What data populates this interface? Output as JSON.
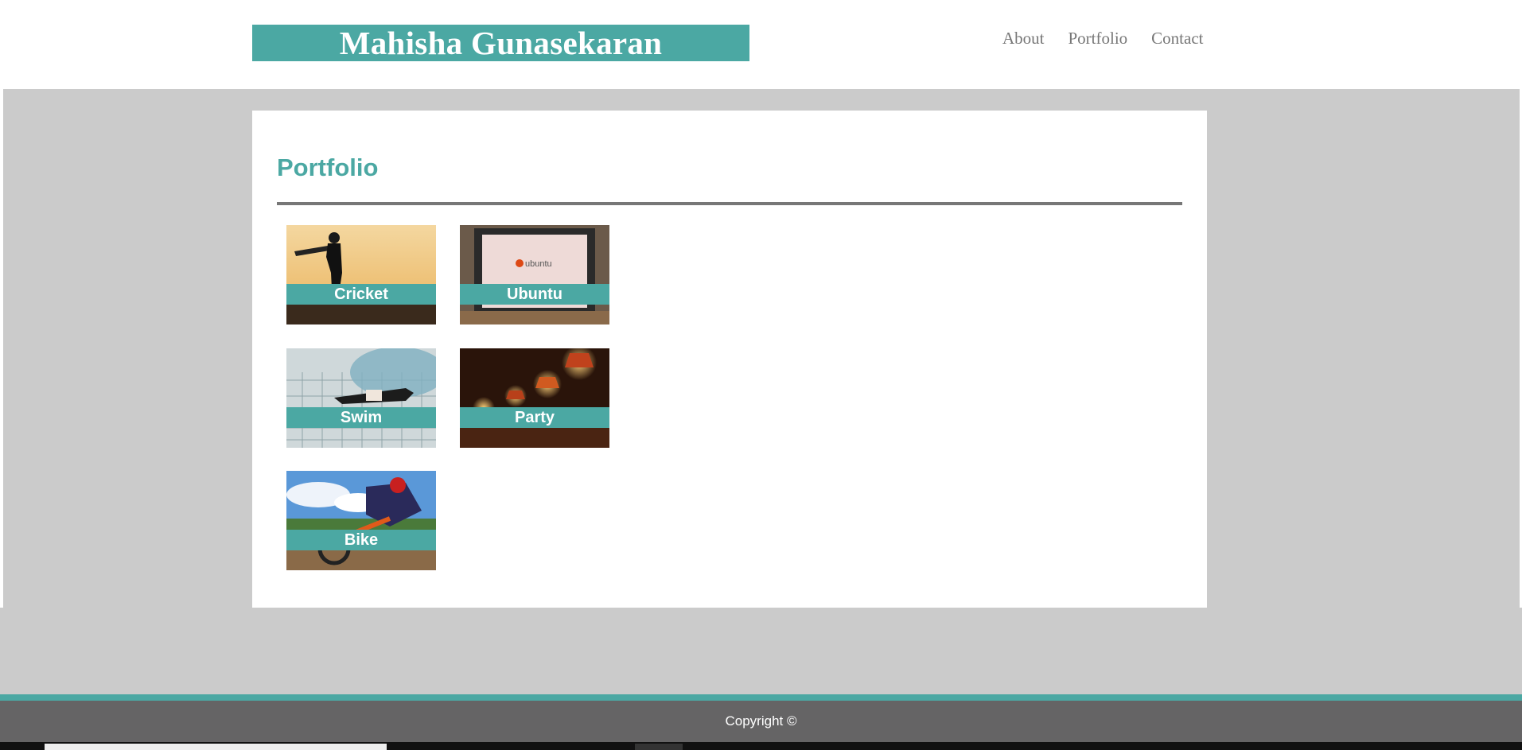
{
  "header": {
    "brand": "Mahisha Gunasekaran",
    "nav": [
      {
        "label": "About"
      },
      {
        "label": "Portfolio"
      },
      {
        "label": "Contact"
      }
    ]
  },
  "main": {
    "title": "Portfolio",
    "items": [
      {
        "label": "Cricket"
      },
      {
        "label": "Ubuntu",
        "image_text": "ubuntu"
      },
      {
        "label": "Swim"
      },
      {
        "label": "Party"
      },
      {
        "label": "Bike"
      }
    ]
  },
  "footer": {
    "copyright": "Copyright ©"
  },
  "colors": {
    "accent": "#4ba8a3",
    "page_band": "#cbcbcb",
    "footer_bg": "#656465",
    "nav_text": "#777777"
  }
}
